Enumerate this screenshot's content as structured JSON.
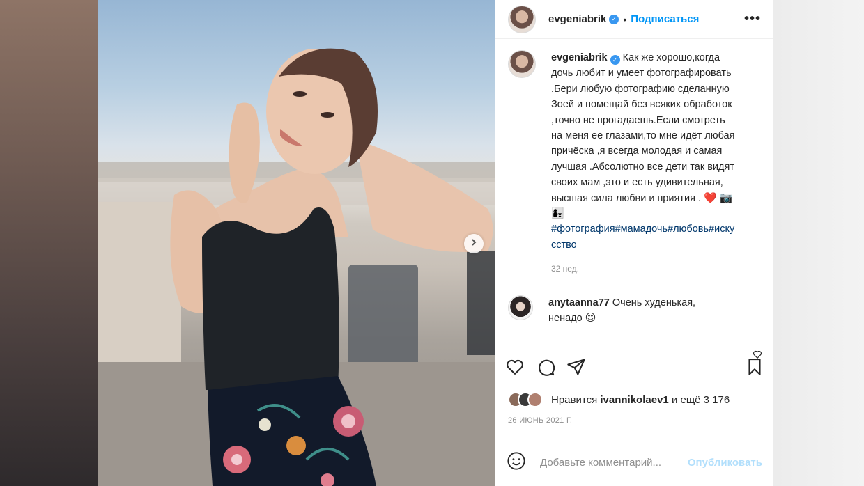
{
  "post": {
    "username": "evgeniabrik",
    "separator": "•",
    "follow_label": "Подписаться",
    "more_label": "•••",
    "caption_lines": [
      "Как же хорошо,когда",
      "дочь любит и умеет фотографировать",
      ".Бери любую фотографию сделанную",
      "Зоей и помещай без всяких обработок",
      ",точно не прогадаешь.Если смотреть",
      "на меня ее глазами,то мне идёт любая",
      "причёска ,я всегда молодая и самая",
      "лучшая .Абсолютно все дети так видят",
      "своих мам ,это и есть удивительная,",
      "высшая сила любви и приятия ."
    ],
    "caption_emoji": "❤️ 📷",
    "caption_emoji2": "👩‍👧",
    "hashtags_line1": "#фотография#мамадочь#любовь#иску",
    "hashtags_line2": "сство",
    "time_ago": "32 нед.",
    "comment": {
      "username": "anytaanna77",
      "text_line1": "Очень худенькая,",
      "text_line2": "ненадо",
      "emoji": "😍"
    },
    "likes": {
      "prefix": "Нравится",
      "user": "ivannikolaev1",
      "suffix": "и ещё 3 176"
    },
    "date": "26 ИЮНЬ 2021 Г.",
    "add_comment_placeholder": "Добавьте комментарий...",
    "publish_label": "Опубликовать"
  },
  "colors": {
    "link_blue": "#0095f6",
    "hashtag": "#00376b",
    "muted": "#8e8e8e",
    "publish_disabled": "#b2dffc"
  },
  "icons": [
    "heart-icon",
    "comment-icon",
    "share-icon",
    "bookmark-icon",
    "emoji-icon",
    "chevron-right-icon",
    "verified-icon"
  ]
}
